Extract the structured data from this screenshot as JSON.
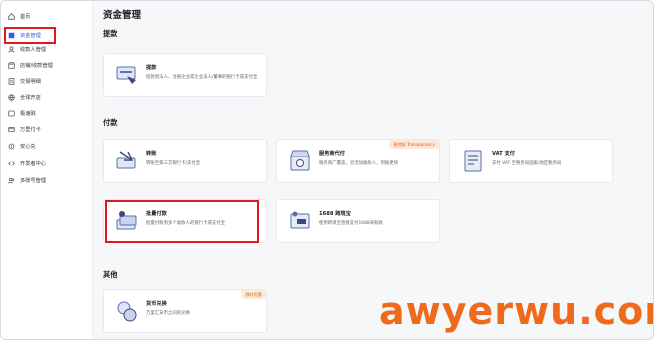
{
  "sidebar": {
    "items": [
      {
        "label": "首页",
        "icon": "home-icon"
      },
      {
        "label": "资金管理",
        "icon": "wallet-icon",
        "active": true
      },
      {
        "label": "收款人管理",
        "icon": "payee-icon"
      },
      {
        "label": "店铺/收款管理",
        "icon": "store-icon"
      },
      {
        "label": "交易明细",
        "icon": "list-icon"
      },
      {
        "label": "全球开店",
        "icon": "globe-icon"
      },
      {
        "label": "极速融",
        "icon": "finance-icon"
      },
      {
        "label": "万里付卡",
        "icon": "card-icon"
      },
      {
        "label": "安心兑",
        "icon": "exchange-icon"
      },
      {
        "label": "开发者中心",
        "icon": "code-icon"
      },
      {
        "label": "多账号管理",
        "icon": "accounts-icon"
      }
    ],
    "accent_color": "#3b5bdb"
  },
  "main": {
    "title": "资金管理",
    "sections": {
      "withdraw": "提款",
      "payment": "付款",
      "other": "其他"
    },
    "cards": {
      "withdraw": {
        "title": "提款",
        "desc": "提款到法人、注册企业或企业法人/董事的银行卡或支付宝"
      },
      "transfer": {
        "title": "转账",
        "desc": "转账至第三方银行卡/支付宝"
      },
      "service_pay": {
        "title": "服务商代付",
        "desc": "服务商广覆盖，灵活加收款人，到账更快",
        "tag": "直付款 Transparency"
      },
      "vat_pay": {
        "title": "VAT 支付",
        "desc": "支付 VAT 至税务局国家/地区税务局"
      },
      "batch_pay": {
        "title": "批量付款",
        "desc": "批量付款到多个收款人的银行卡或支付宝"
      },
      "pay1688": {
        "title": "1688 跨境宝",
        "desc": "使用跨境宝直接支付1688采购款"
      },
      "fx": {
        "title": "货币兑换",
        "desc": "万里汇货币之间的兑换",
        "tag": "限时优惠"
      }
    }
  },
  "watermark": "awyerwu.com",
  "colors": {
    "highlight_border": "#e0191f",
    "watermark": "#f06a1d",
    "tag_orange": "#e0591d"
  }
}
